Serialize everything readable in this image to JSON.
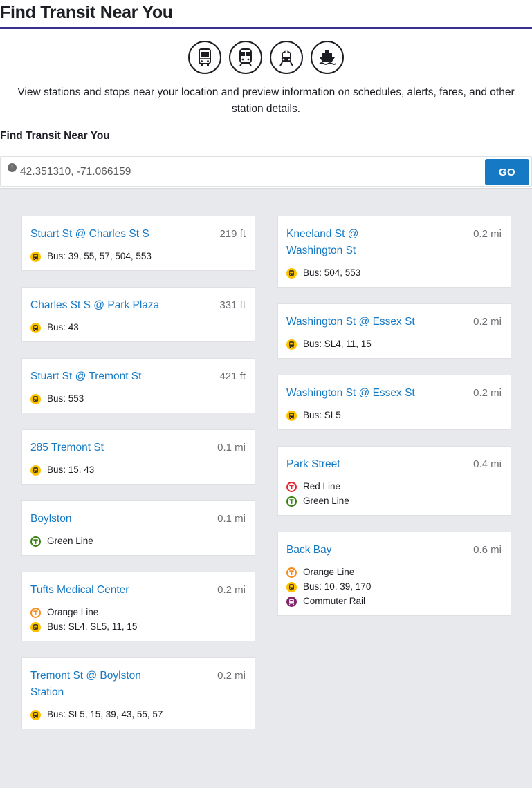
{
  "header": {
    "title": "Find Transit Near You"
  },
  "mode_icons": [
    {
      "name": "bus-icon"
    },
    {
      "name": "subway-icon"
    },
    {
      "name": "commuter-rail-icon"
    },
    {
      "name": "ferry-icon"
    }
  ],
  "intro_text": "View stations and stops near your location and preview information on schedules, alerts, fares, and other station details.",
  "search": {
    "label": "Find Transit Near You",
    "value": "42.351310, -71.066159",
    "go_label": "GO",
    "info_glyph": "!"
  },
  "colors": {
    "title_rule": "#3b2f8f",
    "link": "#1679c4",
    "button": "#1679c4",
    "bus": "#fdc200",
    "red_line": "#e4262e",
    "green_line": "#398212",
    "orange_line": "#f68d1e",
    "commuter_rail": "#80276c"
  },
  "stops_left": [
    {
      "name": "Stuart St @ Charles St S",
      "distance": "219 ft",
      "routes": [
        {
          "type": "bus",
          "icon": "bus-icon",
          "label": "Bus: 39, 55, 57, 504, 553"
        }
      ]
    },
    {
      "name": "Charles St S @ Park Plaza",
      "distance": "331 ft",
      "routes": [
        {
          "type": "bus",
          "icon": "bus-icon",
          "label": "Bus: 43"
        }
      ]
    },
    {
      "name": "Stuart St @ Tremont St",
      "distance": "421 ft",
      "routes": [
        {
          "type": "bus",
          "icon": "bus-icon",
          "label": "Bus: 553"
        }
      ]
    },
    {
      "name": "285 Tremont St",
      "distance": "0.1 mi",
      "routes": [
        {
          "type": "bus",
          "icon": "bus-icon",
          "label": "Bus: 15, 43"
        }
      ]
    },
    {
      "name": "Boylston",
      "distance": "0.1 mi",
      "routes": [
        {
          "type": "green",
          "icon": "green-line-t-icon",
          "label": "Green Line"
        }
      ]
    },
    {
      "name": "Tufts Medical Center",
      "distance": "0.2 mi",
      "routes": [
        {
          "type": "orange",
          "icon": "orange-line-t-icon",
          "label": "Orange Line"
        },
        {
          "type": "bus",
          "icon": "bus-icon",
          "label": "Bus: SL4, SL5, 11, 15"
        }
      ]
    },
    {
      "name": "Tremont St @ Boylston Station",
      "distance": "0.2 mi",
      "routes": [
        {
          "type": "bus",
          "icon": "bus-icon",
          "label": "Bus: SL5, 15, 39, 43, 55, 57"
        }
      ]
    }
  ],
  "stops_right": [
    {
      "name": "Kneeland St @ Washington St",
      "distance": "0.2 mi",
      "routes": [
        {
          "type": "bus",
          "icon": "bus-icon",
          "label": "Bus: 504, 553"
        }
      ]
    },
    {
      "name": "Washington St @ Essex St",
      "distance": "0.2 mi",
      "routes": [
        {
          "type": "bus",
          "icon": "bus-icon",
          "label": "Bus: SL4, 11, 15"
        }
      ]
    },
    {
      "name": "Washington St @ Essex St",
      "distance": "0.2 mi",
      "routes": [
        {
          "type": "bus",
          "icon": "bus-icon",
          "label": "Bus: SL5"
        }
      ]
    },
    {
      "name": "Park Street",
      "distance": "0.4 mi",
      "routes": [
        {
          "type": "red",
          "icon": "red-line-t-icon",
          "label": "Red Line"
        },
        {
          "type": "green",
          "icon": "green-line-t-icon",
          "label": "Green Line"
        }
      ]
    },
    {
      "name": "Back Bay",
      "distance": "0.6 mi",
      "routes": [
        {
          "type": "orange",
          "icon": "orange-line-t-icon",
          "label": "Orange Line"
        },
        {
          "type": "bus",
          "icon": "bus-icon",
          "label": "Bus: 10, 39, 170"
        },
        {
          "type": "commuter",
          "icon": "commuter-rail-icon",
          "label": "Commuter Rail"
        }
      ]
    }
  ]
}
